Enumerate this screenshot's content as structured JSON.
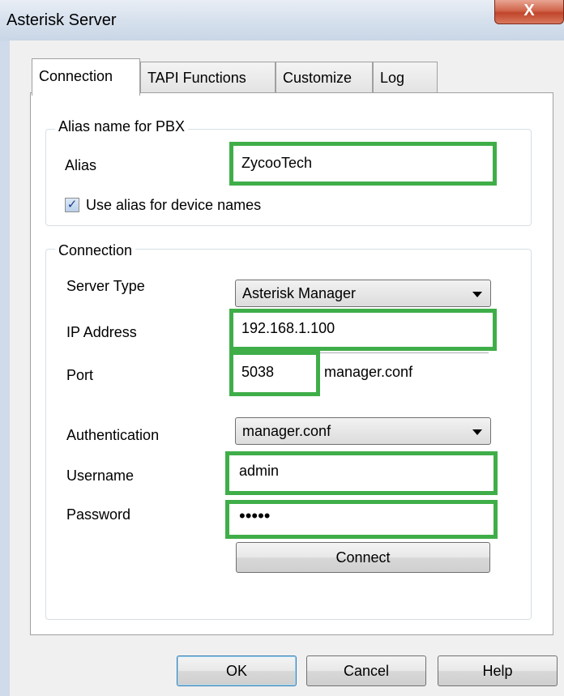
{
  "window": {
    "title": "Asterisk Server",
    "close_label": "X"
  },
  "tabs": [
    {
      "label": "Connection",
      "active": true
    },
    {
      "label": "TAPI Functions",
      "active": false
    },
    {
      "label": "Customize",
      "active": false
    },
    {
      "label": "Log",
      "active": false
    }
  ],
  "alias_group": {
    "legend": "Alias name for PBX",
    "alias_label": "Alias",
    "alias_value": "ZycooTech",
    "use_alias_label": "Use alias for device names",
    "use_alias_checked": true,
    "check_glyph": "✓"
  },
  "connection_group": {
    "legend": "Connection",
    "server_type_label": "Server Type",
    "server_type_value": "Asterisk Manager",
    "ip_label": "IP Address",
    "ip_value": "192.168.1.100",
    "port_label": "Port",
    "port_value": "5038",
    "port_hint": "manager.conf",
    "auth_label": "Authentication",
    "auth_value": "manager.conf",
    "username_label": "Username",
    "username_value": "admin",
    "password_label": "Password",
    "password_value": "•••••",
    "connect_label": "Connect"
  },
  "footer": {
    "ok_label": "OK",
    "cancel_label": "Cancel",
    "help_label": "Help"
  },
  "colors": {
    "highlight": "#3fae49",
    "titlebar": "#d8e2ee",
    "close_button": "#c0452b"
  }
}
